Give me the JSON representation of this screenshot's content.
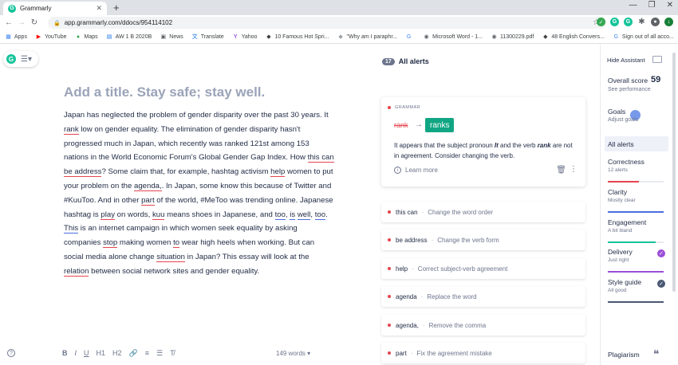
{
  "browser": {
    "tab_title": "Grammarly",
    "tab_close": "✕",
    "new_tab": "+",
    "url": "app.grammarly.com/ddocs/954114102",
    "window_buttons": [
      "—",
      "❐",
      "✕"
    ],
    "bookmarks": [
      {
        "label": "Apps",
        "icon": "apps-grid-icon",
        "color": "#4285f4"
      },
      {
        "label": "YouTube",
        "icon": "youtube-icon",
        "color": "#ff0000"
      },
      {
        "label": "Maps",
        "icon": "maps-pin-icon",
        "color": "#34a853"
      },
      {
        "label": "AW 1 B 2020B",
        "icon": "doc-icon",
        "color": "#1a73e8"
      },
      {
        "label": "News",
        "icon": "news-icon",
        "color": "#5f6368"
      },
      {
        "label": "Translate",
        "icon": "translate-icon",
        "color": "#1a73e8"
      },
      {
        "label": "Yahoo",
        "icon": "yahoo-icon",
        "color": "#6001d2"
      },
      {
        "label": "10 Famous Hot Spri...",
        "icon": "bookmark-icon",
        "color": "#3c4043"
      },
      {
        "label": "\"Why am I paraphr...",
        "icon": "bookmark-icon",
        "color": "#9aa0a6"
      },
      {
        "label": "",
        "icon": "google-icon",
        "color": "#4285f4"
      },
      {
        "label": "Microsoft Word - 1...",
        "icon": "globe-icon",
        "color": "#5f6368"
      },
      {
        "label": "11300229.pdf",
        "icon": "globe-icon",
        "color": "#5f6368"
      },
      {
        "label": "48 English Convers...",
        "icon": "bookmark-icon",
        "color": "#3c4043"
      },
      {
        "label": "Sign out of all acco...",
        "icon": "google-icon",
        "color": "#4285f4"
      }
    ]
  },
  "editor": {
    "title_placeholder": "Add a title. Stay safe; stay well.",
    "word_count": "149 words",
    "word_count_caret": "▾",
    "body": [
      {
        "t": "Japan has neglected the problem of gender disparity over the past 30 years. It "
      },
      {
        "t": "rank",
        "u": "red"
      },
      {
        "t": " low on gender equality. The elimination of gender disparity hasn't progressed much in Japan, which recently was ranked 121st among 153 nations in the World Economic Forum's Global Gender Gap Index. How "
      },
      {
        "t": "this can",
        "u": "red"
      },
      {
        "t": " "
      },
      {
        "t": "be address",
        "u": "red"
      },
      {
        "t": "? Some claim that, for example, hashtag activism "
      },
      {
        "t": "help",
        "u": "red"
      },
      {
        "t": " women to put your problem on the "
      },
      {
        "t": "agenda,",
        "u": "red"
      },
      {
        "t": ". In Japan, some know this because of Twitter and #KuuToo. And in other "
      },
      {
        "t": "part",
        "u": "red"
      },
      {
        "t": " of the world, #MeToo was trending online. Japanese hashtag is "
      },
      {
        "t": "play",
        "u": "red"
      },
      {
        "t": " on words, "
      },
      {
        "t": "kuu",
        "u": "red"
      },
      {
        "t": " means shoes in Japanese, and "
      },
      {
        "t": "too",
        "u": "blue"
      },
      {
        "t": ", "
      },
      {
        "t": "is",
        "u": "blue"
      },
      {
        "t": " "
      },
      {
        "t": "well",
        "u": "blue"
      },
      {
        "t": ", "
      },
      {
        "t": "too",
        "u": "blue"
      },
      {
        "t": ". "
      },
      {
        "t": "This",
        "u": "blue"
      },
      {
        "t": " is an internet campaign in which women seek equality by asking companies "
      },
      {
        "t": "stop",
        "u": "red"
      },
      {
        "t": " making women "
      },
      {
        "t": "to",
        "u": "red"
      },
      {
        "t": " wear high heels when working. But can social media alone change "
      },
      {
        "t": "situation",
        "u": "red"
      },
      {
        "t": " in Japan? This essay will look at the "
      },
      {
        "t": "relation",
        "u": "red"
      },
      {
        "t": " between social network sites and gender equality."
      }
    ],
    "format_buttons": [
      {
        "label": "B",
        "name": "bold-button"
      },
      {
        "label": "I",
        "name": "italic-button"
      },
      {
        "label": "U",
        "name": "underline-button"
      },
      {
        "label": "H1",
        "name": "h1-button"
      },
      {
        "label": "H2",
        "name": "h2-button"
      },
      {
        "label": "🔗",
        "name": "link-button"
      },
      {
        "label": "≡",
        "name": "ordered-list-button"
      },
      {
        "label": "☰",
        "name": "bullet-list-button"
      },
      {
        "label": "T̸",
        "name": "clear-format-button"
      }
    ]
  },
  "alerts": {
    "count": "17",
    "label": "All alerts",
    "card": {
      "category": "GRAMMAR",
      "original": "rank",
      "arrow": "→",
      "suggestion": "ranks",
      "explanation_parts": [
        {
          "t": "It appears that the subject pronoun "
        },
        {
          "t": "It",
          "em": true
        },
        {
          "t": " and the verb "
        },
        {
          "t": "rank",
          "em": true
        },
        {
          "t": " are not in agreement. Consider changing the verb."
        }
      ],
      "learn_more": "Learn more"
    },
    "list": [
      {
        "word": "this can",
        "hint": "Change the word order",
        "color": "#e5454f"
      },
      {
        "word": "be address",
        "hint": "Change the verb form",
        "color": "#e5454f"
      },
      {
        "word": "help",
        "hint": "Correct subject-verb agreement",
        "color": "#e5454f"
      },
      {
        "word": "agenda",
        "hint": "Replace the word",
        "color": "#e5454f"
      },
      {
        "word": "agenda,",
        "hint": "Remove the comma",
        "color": "#e5454f"
      },
      {
        "word": "part",
        "hint": "Fix the agreement mistake",
        "color": "#e5454f"
      }
    ],
    "separator": "·"
  },
  "sidebar": {
    "hide_assistant": "Hide Assistant",
    "overall_label": "Overall score",
    "overall_score": "59",
    "see_performance": "See performance",
    "goals": "Goals",
    "adjust_goals": "Adjust goals",
    "all_alerts": "All alerts",
    "categories": [
      {
        "name": "Correctness",
        "sub": "12 alerts",
        "color": "#e5454f",
        "fill": 0.55,
        "check": false
      },
      {
        "name": "Clarity",
        "sub": "Mostly clear",
        "color": "#4a6ee0",
        "fill": 1.0,
        "check": false
      },
      {
        "name": "Engagement",
        "sub": "A bit bland",
        "color": "#15c39a",
        "fill": 0.85,
        "check": false
      },
      {
        "name": "Delivery",
        "sub": "Just right",
        "color": "#9c4fd6",
        "fill": 1.0,
        "check": true
      },
      {
        "name": "Style guide",
        "sub": "All good",
        "color": "#4a5874",
        "fill": 1.0,
        "check": true
      }
    ],
    "plagiarism": "Plagiarism"
  }
}
